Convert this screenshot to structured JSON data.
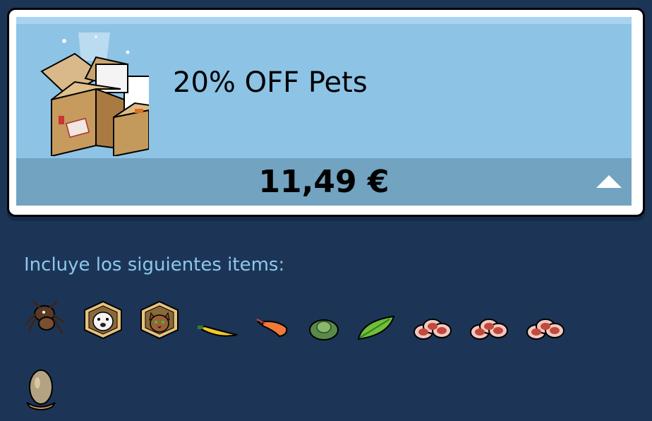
{
  "offer": {
    "title": "20% OFF Pets",
    "price": "11,49 €"
  },
  "includes_label": "Incluye los siguientes items:",
  "colors": {
    "background": "#1c3556",
    "card_face": "#8dc3e5",
    "card_bottom": "#72a3c0",
    "includes_text": "#8ec7ec"
  },
  "items": [
    {
      "name": "spider-pet-icon"
    },
    {
      "name": "polar-bear-pet-box-icon"
    },
    {
      "name": "cat-pet-box-icon"
    },
    {
      "name": "yellow-chili-pepper-icon"
    },
    {
      "name": "shrimp-icon"
    },
    {
      "name": "cabbage-icon"
    },
    {
      "name": "green-leaf-icon"
    },
    {
      "name": "ham-slices-icon"
    },
    {
      "name": "ham-slices-icon"
    },
    {
      "name": "ham-slices-icon"
    },
    {
      "name": "egg-on-hand-icon"
    }
  ]
}
